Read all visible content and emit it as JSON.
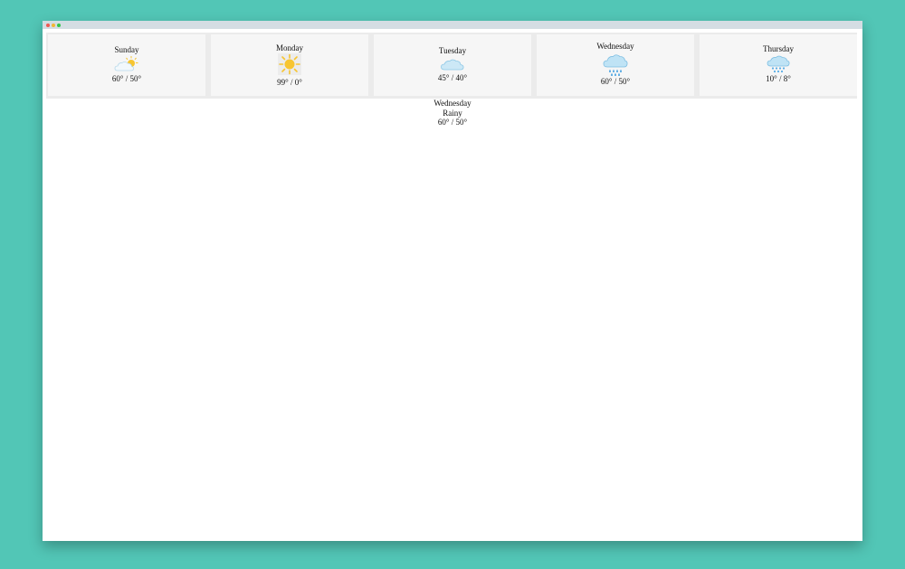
{
  "forecast": [
    {
      "day": "Sunday",
      "icon": "partly-cloudy-icon",
      "temp": "60° / 50°"
    },
    {
      "day": "Monday",
      "icon": "sunny-icon",
      "temp": "99° / 0°"
    },
    {
      "day": "Tuesday",
      "icon": "cloudy-icon",
      "temp": "45° / 40°"
    },
    {
      "day": "Wednesday",
      "icon": "rainy-icon",
      "temp": "60° / 50°"
    },
    {
      "day": "Thursday",
      "icon": "snowy-icon",
      "temp": "10° / 8°"
    }
  ],
  "selected": {
    "day": "Wednesday",
    "condition": "Rainy",
    "temp": "60° / 50°"
  },
  "colors": {
    "background": "#52c6b6",
    "cloud": "#bfe3f5",
    "sun": "#f7c531",
    "rain": "#3f9de0"
  }
}
